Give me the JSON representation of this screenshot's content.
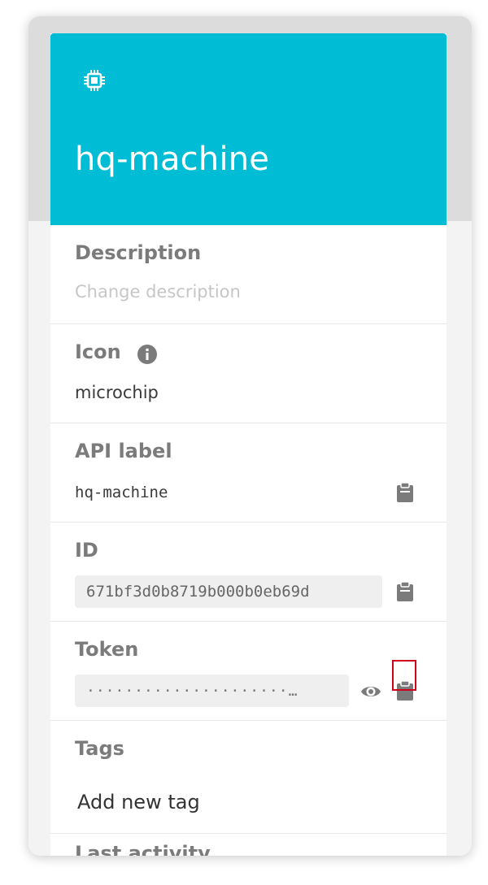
{
  "header": {
    "title": "hq-machine",
    "icon": "microchip-icon",
    "color": "#00bcd4"
  },
  "description": {
    "label": "Description",
    "placeholder": "Change description"
  },
  "icon_section": {
    "label": "Icon",
    "value": "microchip",
    "info_icon": "info-icon"
  },
  "api_label": {
    "label": "API label",
    "value": "hq-machine"
  },
  "id_section": {
    "label": "ID",
    "value": "671bf3d0b8719b000b0eb69d"
  },
  "token": {
    "label": "Token",
    "masked": "·····················…"
  },
  "tags": {
    "label": "Tags",
    "add_label": "Add new tag"
  },
  "next_section": {
    "label": "Last activity"
  },
  "colors": {
    "highlight": "#d0021b"
  }
}
